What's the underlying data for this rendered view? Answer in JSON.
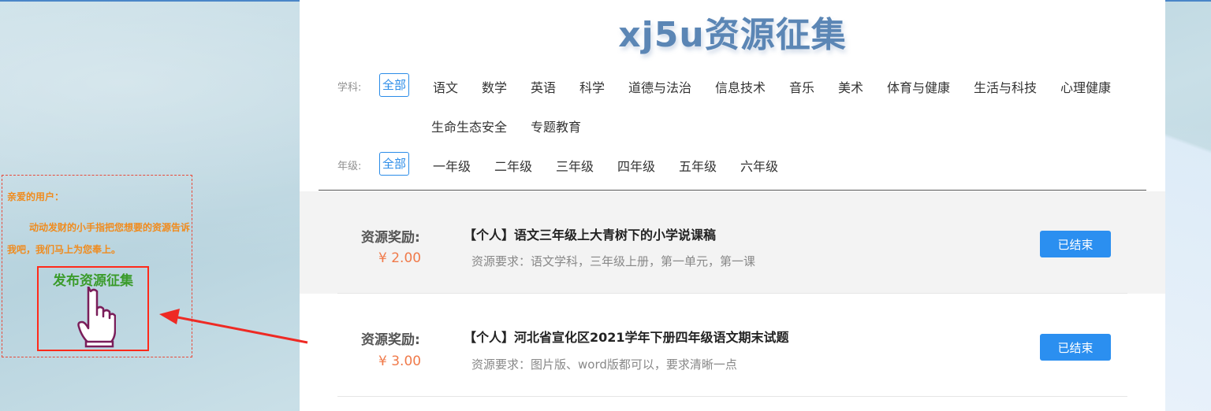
{
  "site": {
    "title": "xj5u资源征集"
  },
  "filters": {
    "subject": {
      "label": "学科:",
      "options": [
        "全部",
        "语文",
        "数学",
        "英语",
        "科学",
        "道德与法治",
        "信息技术",
        "音乐",
        "美术",
        "体育与健康",
        "生活与科技",
        "心理健康",
        "生命生态安全",
        "专题教育"
      ]
    },
    "grade": {
      "label": "年级:",
      "options": [
        "全部",
        "一年级",
        "二年级",
        "三年级",
        "四年级",
        "五年级",
        "六年级"
      ]
    }
  },
  "tasks": [
    {
      "reward_label": "资源奖励:",
      "reward": "¥ 2.00",
      "title": "【个人】语文三年级上大青树下的小学说课稿",
      "requirement": "资源要求：语文学科，三年级上册，第一单元，第一课",
      "status": "已结束"
    },
    {
      "reward_label": "资源奖励:",
      "reward": "¥ 3.00",
      "title": "【个人】河北省宣化区2021学年下册四年级语文期末试题",
      "requirement": "资源要求：图片版、word版都可以，要求清晰一点",
      "status": "已结束"
    }
  ],
  "promo": {
    "greeting": "亲爱的用户：",
    "message": "动动发财的小手指把您想要的资源告诉我吧，我们马上为您奉上。",
    "cta_label": "发布资源征集",
    "cta_icon": "pointing-hand-icon"
  },
  "colors": {
    "accent": "#2b8ff0",
    "title": "#5b86b5",
    "reward": "#f07a4a",
    "promo_text": "#f08b1d",
    "promo_cta": "#3a9b2a",
    "highlight_border": "#ff2a1a"
  }
}
